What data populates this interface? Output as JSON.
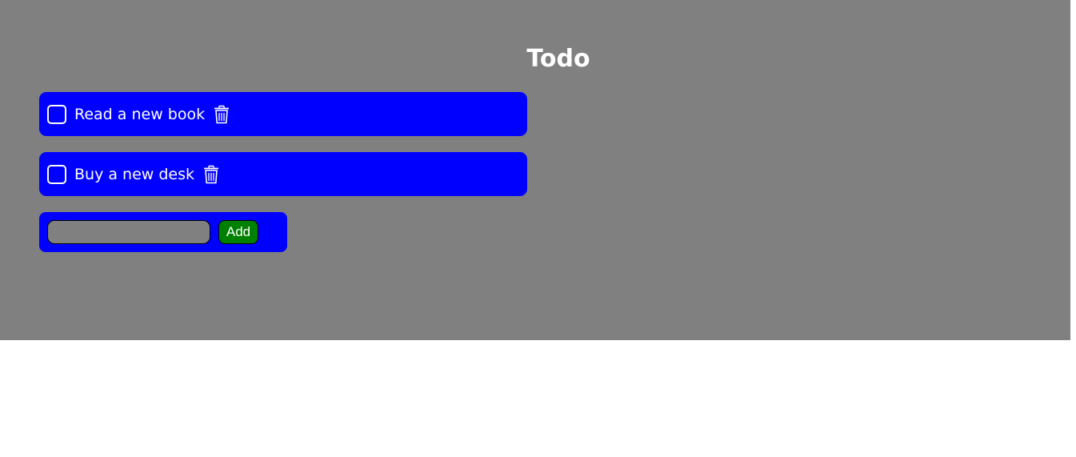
{
  "app": {
    "title": "Todo"
  },
  "todos": [
    {
      "text": "Read a new book",
      "checked": false,
      "delete_icon": "trash-icon"
    },
    {
      "text": "Buy a new desk",
      "checked": false,
      "delete_icon": "trash-icon"
    }
  ],
  "new_todo": {
    "value": "",
    "placeholder": "",
    "add_label": "Add"
  },
  "colors": {
    "background": "#808080",
    "item_background": "#0000ff",
    "add_button": "#008000",
    "text": "#ffffff"
  }
}
